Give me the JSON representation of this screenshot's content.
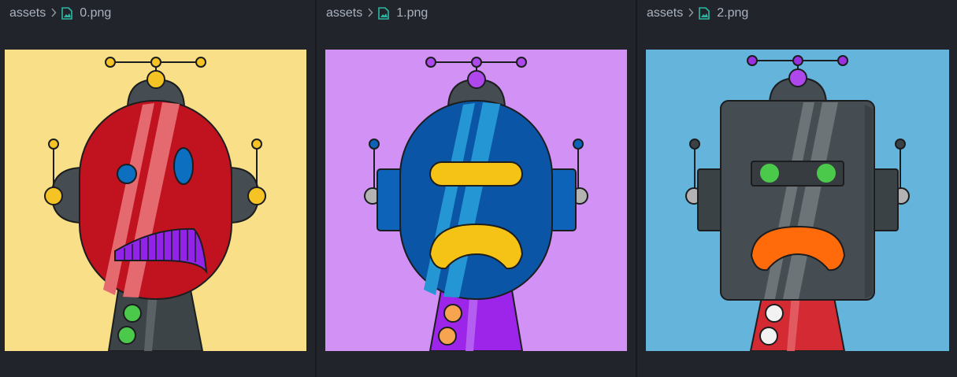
{
  "panes": [
    {
      "breadcrumb_folder": "assets",
      "file_name": "0.png",
      "bg_color": "#f9df87"
    },
    {
      "breadcrumb_folder": "assets",
      "file_name": "1.png",
      "bg_color": "#d291f4"
    },
    {
      "breadcrumb_folder": "assets",
      "file_name": "2.png",
      "bg_color": "#64b4dc"
    }
  ],
  "icons": {
    "breadcrumb_separator": "chevron-right-icon",
    "file_icon": "image-file-icon"
  },
  "colors": {
    "editor_bg": "#21252b",
    "breadcrumb_text": "#abb2bf",
    "image_file_icon": "#2cb7a3"
  }
}
